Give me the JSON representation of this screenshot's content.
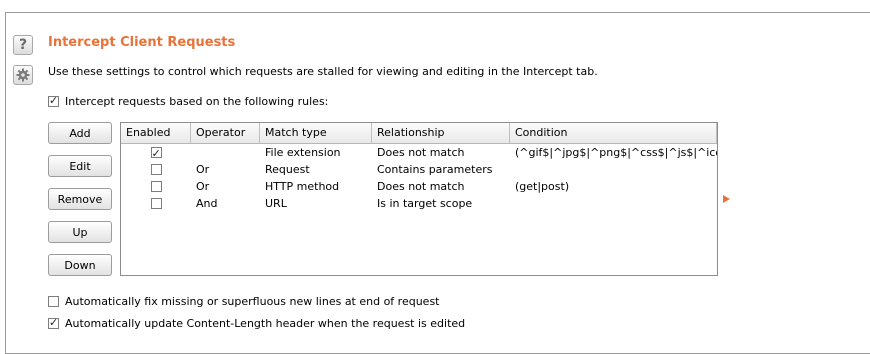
{
  "section": {
    "title": "Intercept Client Requests",
    "description": "Use these settings to control which requests are stalled for viewing and editing in the Intercept tab.",
    "intercept_rules_label": "Intercept requests based on the following rules:",
    "intercept_rules_checked": true
  },
  "buttons": {
    "add": "Add",
    "edit": "Edit",
    "remove": "Remove",
    "up": "Up",
    "down": "Down"
  },
  "table": {
    "headers": [
      "Enabled",
      "Operator",
      "Match type",
      "Relationship",
      "Condition"
    ],
    "rows": [
      {
        "enabled": true,
        "operator": "",
        "match_type": "File extension",
        "relationship": "Does not match",
        "condition": "(^gif$|^jpg$|^png$|^css$|^js$|^ico$)"
      },
      {
        "enabled": false,
        "operator": "Or",
        "match_type": "Request",
        "relationship": "Contains parameters",
        "condition": ""
      },
      {
        "enabled": false,
        "operator": "Or",
        "match_type": "HTTP method",
        "relationship": "Does not match",
        "condition": "(get|post)"
      },
      {
        "enabled": false,
        "operator": "And",
        "match_type": "URL",
        "relationship": "Is in target scope",
        "condition": ""
      }
    ]
  },
  "options": {
    "fix_newlines_label": "Automatically fix missing or superfluous new lines at end of request",
    "fix_newlines_checked": false,
    "update_content_length_label": "Automatically update Content-Length header when the request is edited",
    "update_content_length_checked": true
  },
  "icons": {
    "help": "help-icon",
    "settings": "gear-icon",
    "expand": "triangle-right-icon"
  },
  "colors": {
    "accent": "#e8733a"
  }
}
